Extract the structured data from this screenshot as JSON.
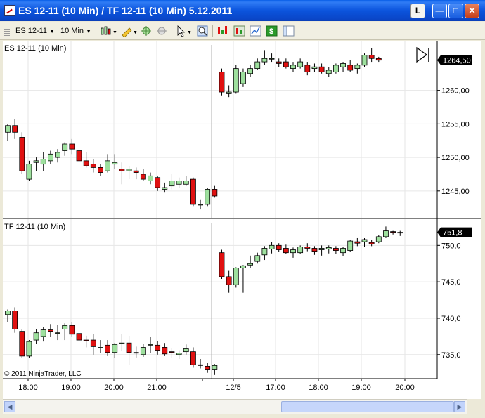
{
  "window": {
    "title": "ES 12-11 (10 Min) / TF 12-11 (10 Min)  5.12.2011",
    "l_button": "L"
  },
  "toolbar": {
    "instrument": "ES 12-11",
    "interval": "10 Min"
  },
  "copyright": "© 2011 NinjaTrader, LLC",
  "colors": {
    "up": "#9ee09e",
    "down": "#e01010",
    "wick": "#000000",
    "grid": "#e6e6e6"
  },
  "chart_data": [
    {
      "type": "candlestick",
      "title": "ES 12-11 (10 Min)",
      "ylim": [
        1241.0,
        1267.4
      ],
      "y_ticks": [
        "1245,00",
        "1250,00",
        "1255,00",
        "1260,00"
      ],
      "y_tick_values": [
        1245,
        1250,
        1255,
        1260
      ],
      "last_price": "1264,50",
      "last_value": 1264.5,
      "candles": [
        [
          1253.75,
          1255.0,
          1252.5,
          1254.75
        ],
        [
          1254.75,
          1255.75,
          1252.75,
          1253.75
        ],
        [
          1253.0,
          1253.75,
          1247.5,
          1248.0
        ],
        [
          1246.75,
          1249.5,
          1246.5,
          1249.0
        ],
        [
          1249.25,
          1250.0,
          1248.0,
          1249.5
        ],
        [
          1249.0,
          1250.75,
          1248.0,
          1249.75
        ],
        [
          1249.5,
          1251.0,
          1249.0,
          1250.5
        ],
        [
          1250.0,
          1251.25,
          1249.25,
          1250.75
        ],
        [
          1251.0,
          1252.25,
          1250.25,
          1252.0
        ],
        [
          1252.0,
          1252.75,
          1250.5,
          1251.25
        ],
        [
          1251.0,
          1251.75,
          1249.0,
          1249.5
        ],
        [
          1249.5,
          1250.75,
          1248.5,
          1248.75
        ],
        [
          1249.0,
          1249.75,
          1247.75,
          1248.5
        ],
        [
          1248.5,
          1249.0,
          1247.25,
          1247.75
        ],
        [
          1248.0,
          1250.5,
          1247.75,
          1249.5
        ],
        [
          1249.0,
          1250.5,
          1248.25,
          1249.25
        ],
        [
          1248.25,
          1249.25,
          1246.0,
          1248.0
        ],
        [
          1248.0,
          1248.75,
          1246.75,
          1248.25
        ],
        [
          1248.0,
          1248.5,
          1246.75,
          1247.75
        ],
        [
          1247.5,
          1248.25,
          1246.5,
          1246.75
        ],
        [
          1246.5,
          1247.75,
          1246.0,
          1247.25
        ],
        [
          1247.0,
          1247.25,
          1245.0,
          1245.5
        ],
        [
          1245.25,
          1246.25,
          1244.75,
          1245.5
        ],
        [
          1245.75,
          1247.5,
          1245.25,
          1246.5
        ],
        [
          1246.0,
          1247.0,
          1245.5,
          1246.5
        ],
        [
          1246.0,
          1247.25,
          1245.75,
          1246.5
        ],
        [
          1246.75,
          1247.0,
          1242.75,
          1243.0
        ],
        [
          1243.0,
          1243.75,
          1242.25,
          1243.0
        ],
        [
          1243.0,
          1245.5,
          1242.75,
          1245.25
        ],
        [
          1245.25,
          1245.75,
          1244.0,
          1244.25
        ],
        [
          1262.75,
          1263.25,
          1259.25,
          1259.75
        ],
        [
          1259.5,
          1260.75,
          1259.0,
          1259.75
        ],
        [
          1259.75,
          1263.75,
          1259.5,
          1263.25
        ],
        [
          1261.0,
          1263.25,
          1260.5,
          1262.75
        ],
        [
          1262.5,
          1263.75,
          1262.0,
          1263.25
        ],
        [
          1263.25,
          1264.75,
          1263.0,
          1264.25
        ],
        [
          1264.25,
          1266.0,
          1263.75,
          1264.75
        ],
        [
          1264.75,
          1265.5,
          1264.25,
          1264.75
        ],
        [
          1264.25,
          1264.75,
          1263.5,
          1264.0
        ],
        [
          1264.25,
          1264.75,
          1263.25,
          1263.5
        ],
        [
          1263.25,
          1264.25,
          1262.75,
          1263.75
        ],
        [
          1263.5,
          1264.75,
          1263.25,
          1264.25
        ],
        [
          1263.75,
          1264.25,
          1262.25,
          1262.75
        ],
        [
          1263.25,
          1264.0,
          1262.75,
          1263.5
        ],
        [
          1263.5,
          1264.0,
          1262.5,
          1262.75
        ],
        [
          1262.5,
          1263.5,
          1262.0,
          1263.0
        ],
        [
          1262.75,
          1264.0,
          1262.5,
          1263.75
        ],
        [
          1263.5,
          1264.25,
          1262.75,
          1264.0
        ],
        [
          1263.75,
          1264.5,
          1262.75,
          1263.0
        ],
        [
          1263.25,
          1264.0,
          1262.5,
          1263.75
        ],
        [
          1263.75,
          1265.5,
          1263.5,
          1265.25
        ],
        [
          1265.25,
          1266.25,
          1264.25,
          1264.75
        ],
        [
          1264.75,
          1265.0,
          1264.25,
          1264.5
        ]
      ]
    },
    {
      "type": "candlestick",
      "title": "TF 12-11 (10 Min)",
      "ylim": [
        731.7,
        753.6
      ],
      "y_ticks": [
        "735,0",
        "740,0",
        "745,0",
        "750,0"
      ],
      "y_tick_values": [
        735,
        740,
        745,
        750
      ],
      "last_price": "751,8",
      "last_value": 751.8,
      "candles": [
        [
          740.5,
          741.2,
          739.5,
          741.0
        ],
        [
          741.0,
          741.5,
          738.0,
          738.5
        ],
        [
          738.2,
          738.5,
          734.5,
          734.8
        ],
        [
          734.8,
          737.0,
          734.5,
          736.8
        ],
        [
          737.0,
          738.5,
          736.5,
          738.0
        ],
        [
          737.5,
          738.8,
          736.8,
          738.4
        ],
        [
          738.4,
          739.2,
          737.4,
          738.2
        ],
        [
          738.0,
          739.1,
          737.0,
          738.0
        ],
        [
          738.5,
          739.3,
          737.0,
          739.0
        ],
        [
          739.0,
          739.5,
          737.5,
          737.8
        ],
        [
          737.9,
          738.3,
          736.4,
          737.0
        ],
        [
          737.0,
          737.6,
          736.0,
          736.9
        ],
        [
          737.0,
          737.8,
          735.0,
          736.1
        ],
        [
          736.0,
          737.0,
          735.2,
          736.0
        ],
        [
          736.3,
          737.0,
          734.8,
          735.3
        ],
        [
          735.3,
          736.6,
          734.5,
          736.4
        ],
        [
          736.6,
          737.8,
          735.5,
          736.6
        ],
        [
          736.6,
          737.6,
          733.6,
          735.3
        ],
        [
          735.3,
          736.1,
          734.6,
          735.2
        ],
        [
          735.0,
          736.5,
          734.7,
          736.0
        ],
        [
          736.3,
          737.4,
          735.2,
          736.4
        ],
        [
          736.3,
          736.9,
          735.0,
          735.6
        ],
        [
          736.0,
          736.6,
          734.8,
          735.1
        ],
        [
          735.4,
          735.9,
          734.5,
          735.3
        ],
        [
          735.0,
          735.6,
          734.4,
          735.2
        ],
        [
          735.4,
          736.4,
          735.0,
          735.8
        ],
        [
          735.4,
          736.0,
          733.2,
          733.6
        ],
        [
          733.6,
          734.4,
          733.1,
          733.5
        ],
        [
          733.4,
          733.9,
          732.5,
          733.0
        ],
        [
          733.0,
          733.7,
          732.2,
          733.5
        ],
        [
          749.0,
          749.4,
          745.4,
          745.7
        ],
        [
          745.7,
          746.5,
          743.5,
          744.6
        ],
        [
          744.6,
          747.0,
          744.2,
          746.9
        ],
        [
          746.9,
          747.3,
          743.5,
          747.2
        ],
        [
          747.3,
          748.6,
          746.9,
          747.5
        ],
        [
          747.8,
          749.0,
          747.5,
          748.6
        ],
        [
          748.7,
          749.9,
          748.0,
          749.6
        ],
        [
          749.5,
          750.5,
          748.9,
          750.0
        ],
        [
          750.0,
          750.3,
          749.1,
          749.4
        ],
        [
          749.6,
          750.1,
          748.8,
          749.0
        ],
        [
          749.0,
          749.7,
          748.3,
          749.4
        ],
        [
          749.0,
          750.0,
          748.8,
          749.8
        ],
        [
          749.8,
          750.3,
          749.2,
          749.6
        ],
        [
          749.6,
          749.9,
          748.7,
          749.2
        ],
        [
          749.4,
          750.0,
          748.6,
          749.6
        ],
        [
          749.5,
          750.0,
          748.9,
          749.7
        ],
        [
          749.6,
          749.9,
          748.8,
          749.3
        ],
        [
          749.0,
          749.8,
          748.5,
          749.6
        ],
        [
          749.3,
          750.8,
          749.1,
          750.6
        ],
        [
          750.5,
          751.0,
          749.9,
          750.3
        ],
        [
          750.5,
          751.0,
          749.8,
          750.8
        ],
        [
          750.4,
          750.8,
          749.9,
          750.2
        ],
        [
          750.5,
          751.4,
          750.3,
          751.2
        ],
        [
          751.2,
          752.6,
          751.0,
          752.0
        ],
        [
          751.9,
          752.0,
          751.5,
          751.8
        ],
        [
          751.8,
          752.0,
          751.3,
          751.8
        ]
      ]
    }
  ],
  "x_axis": {
    "labels": [
      "18:00",
      "19:00",
      "20:00",
      "21:00",
      "12/5",
      "17:00",
      "18:00",
      "19:00",
      "20:00"
    ]
  }
}
